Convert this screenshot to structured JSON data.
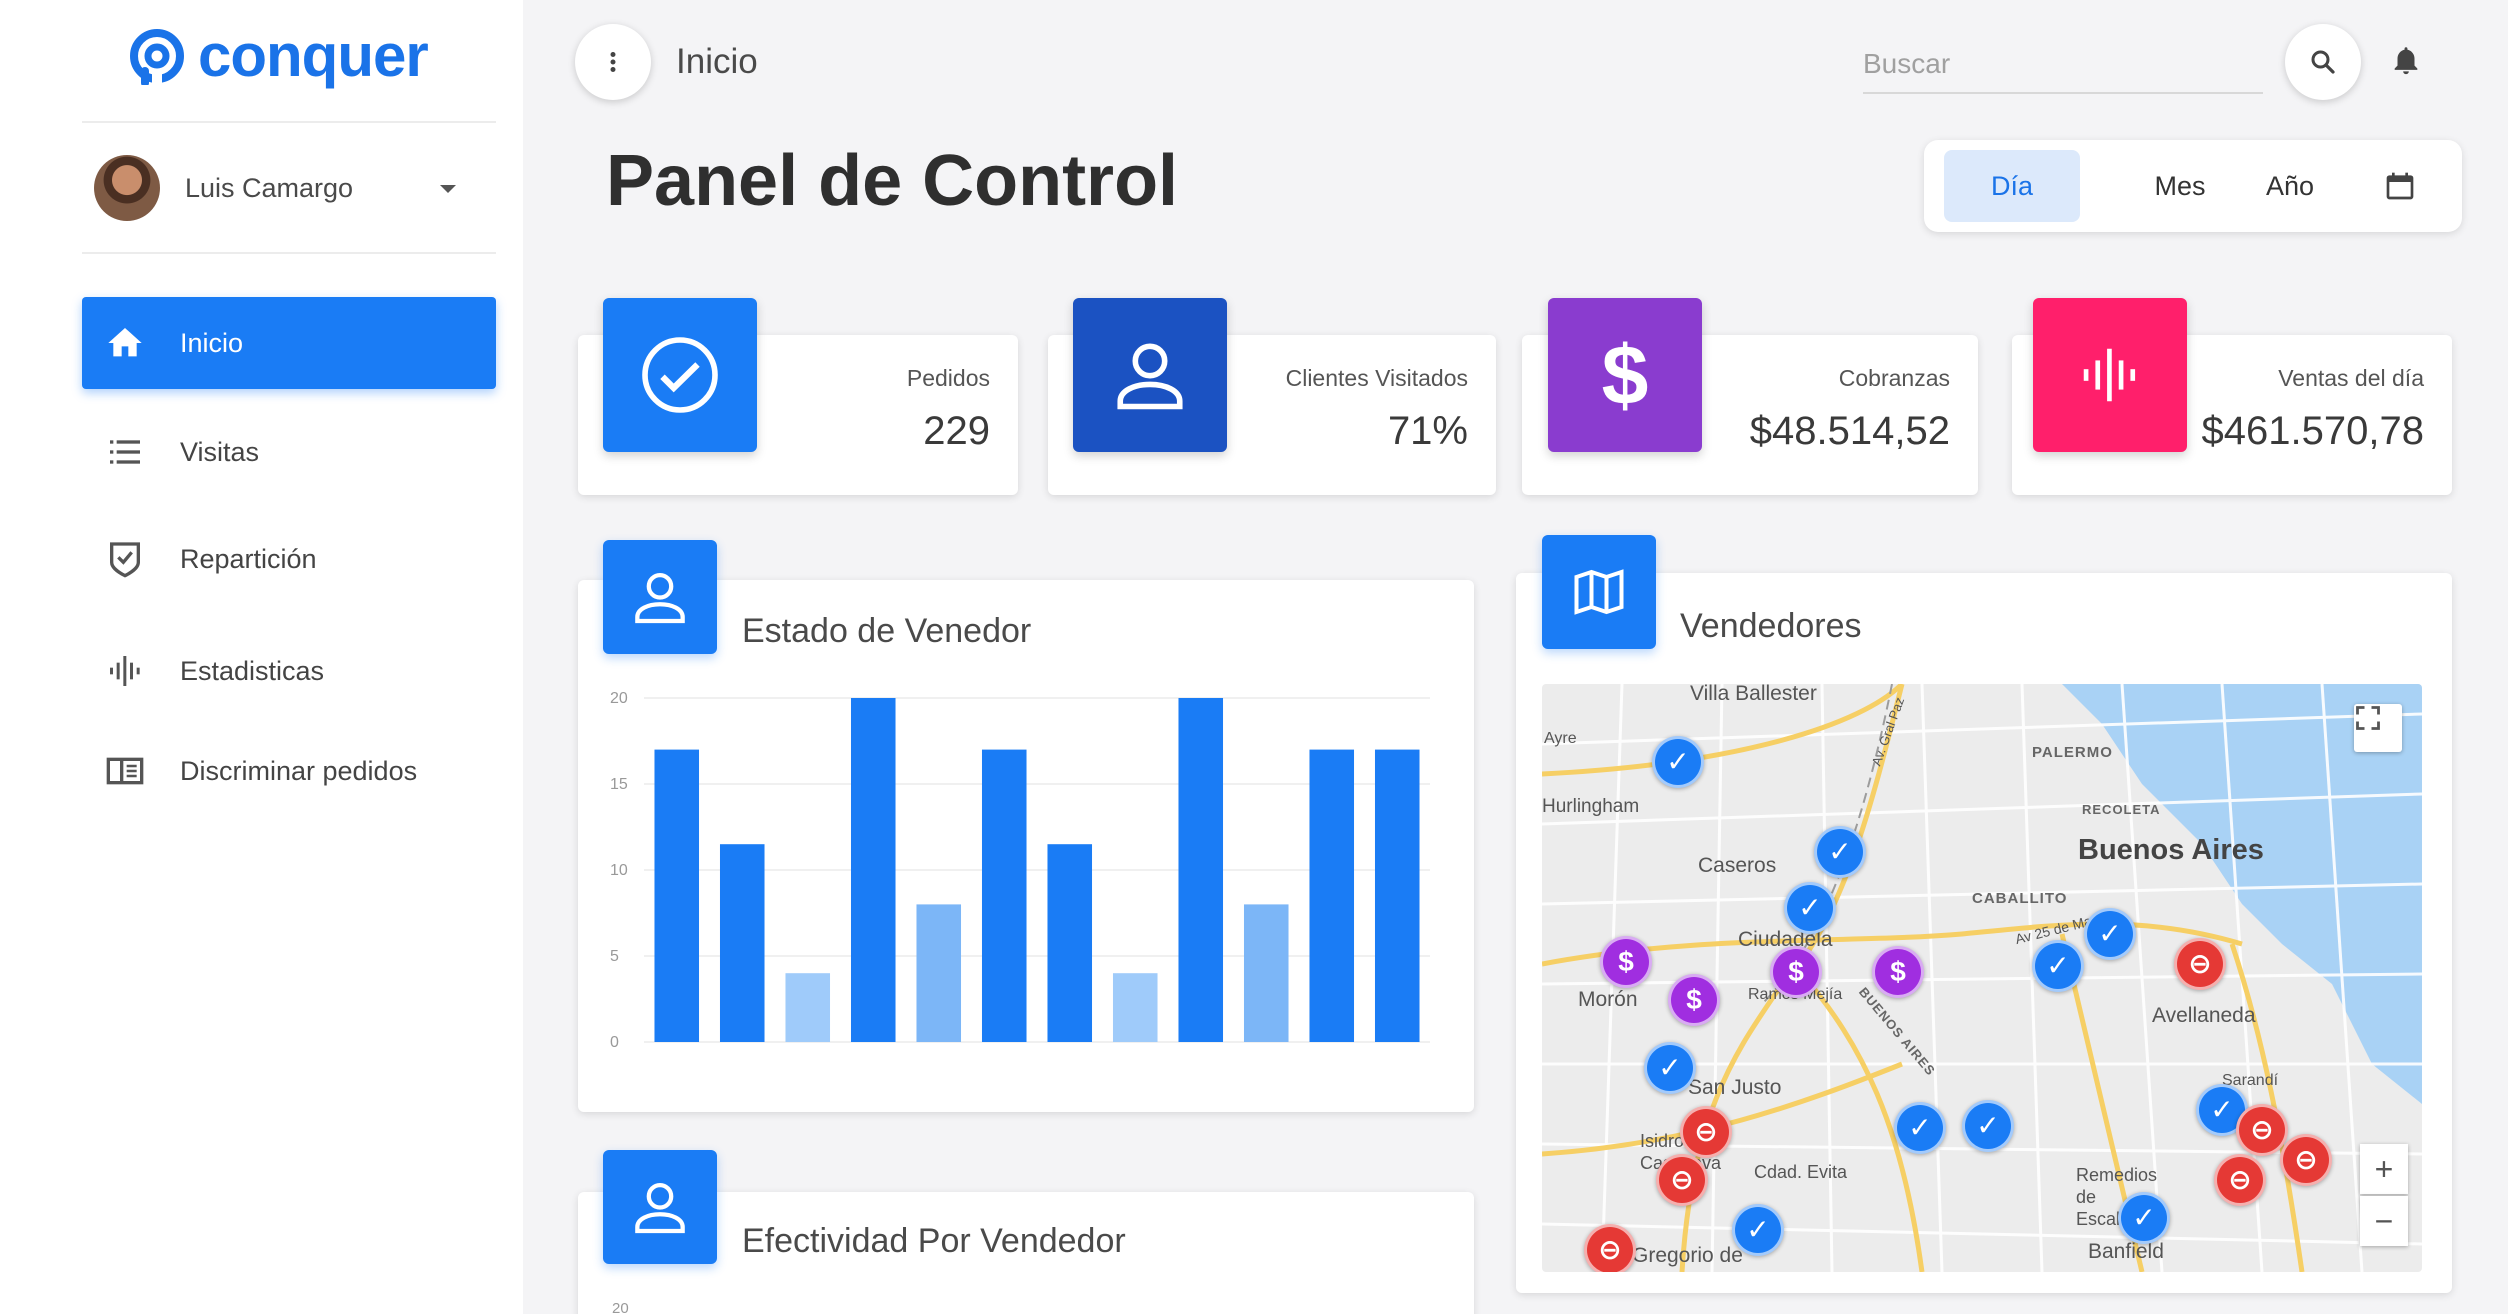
{
  "brand": {
    "name": "conquer",
    "color": "#1a73e8"
  },
  "sidebar": {
    "user": {
      "name": "Luis Camargo"
    },
    "items": [
      {
        "label": "Inicio",
        "icon": "home-icon",
        "active": true
      },
      {
        "label": "Visitas",
        "icon": "list-icon",
        "active": false
      },
      {
        "label": "Repartición",
        "icon": "shield-check-icon",
        "active": false
      },
      {
        "label": "Estadisticas",
        "icon": "waveform-icon",
        "active": false
      },
      {
        "label": "Discriminar pedidos",
        "icon": "book-icon",
        "active": false
      }
    ]
  },
  "topbar": {
    "breadcrumb": "Inicio",
    "search_placeholder": "Buscar",
    "menu_icon": "more-vert-icon",
    "search_icon": "search-icon",
    "bell_icon": "bell-icon"
  },
  "page_title": "Panel de Control",
  "period": {
    "options": [
      "Día",
      "Mes",
      "Año"
    ],
    "selected": "Día",
    "calendar_icon": "calendar-icon"
  },
  "stats": [
    {
      "label": "Pedidos",
      "value": "229",
      "color": "#1a7cf5",
      "icon": "check-circle-icon"
    },
    {
      "label": "Clientes Visitados",
      "value": "71%",
      "color": "#1b52c2",
      "icon": "person-icon"
    },
    {
      "label": "Cobranzas",
      "value": "$48.514,52",
      "color": "#8a3ccf",
      "icon": "dollar-icon"
    },
    {
      "label": "Ventas del día",
      "value": "$461.570,78",
      "color": "#ff1f6b",
      "icon": "waveform-icon"
    }
  ],
  "panels": {
    "estado": {
      "title": "Estado de Venedor",
      "icon": "person-icon"
    },
    "efectividad": {
      "title": "Efectividad Por Vendedor",
      "icon": "person-icon"
    },
    "vendedores": {
      "title": "Vendedores",
      "icon": "map-icon"
    }
  },
  "chart_data": {
    "type": "bar",
    "title": "Estado de Venedor",
    "xlabel": "",
    "ylabel": "",
    "ylim": [
      0,
      20
    ],
    "yticks": [
      "0",
      "5",
      "10",
      "15",
      "20"
    ],
    "grid": true,
    "values": [
      17,
      11.5,
      4,
      20,
      8,
      17,
      11.5,
      4,
      20,
      8,
      17,
      17
    ],
    "colors": [
      "#1a7cf5",
      "#1a7cf5",
      "#9fcbfa",
      "#1a7cf5",
      "#7cb6f7",
      "#1a7cf5",
      "#1a7cf5",
      "#9fcbfa",
      "#1a7cf5",
      "#7cb6f7",
      "#1a7cf5",
      "#1a7cf5"
    ]
  },
  "efectividad_chart": {
    "ytick_top": "20"
  },
  "map": {
    "places": [
      "Villa Ballester",
      "Ayre",
      "Hurlingham",
      "Caseros",
      "Ciudadela",
      "Morón",
      "Ramos Mejía",
      "San Justo",
      "Isidro Casanova",
      "Cdad. Evita",
      "Gregorio de",
      "PALERMO",
      "RECOLETA",
      "Buenos Aires",
      "CABALLITO",
      "Av 25 de Mayo",
      "Avellaneda",
      "Sarandí",
      "Remedios de Escalada",
      "Banfield",
      "BUENOS AIRES",
      "Av. Gral Paz"
    ],
    "fullscreen_icon": "fullscreen-icon",
    "zoom_in": "+",
    "zoom_out": "−"
  }
}
